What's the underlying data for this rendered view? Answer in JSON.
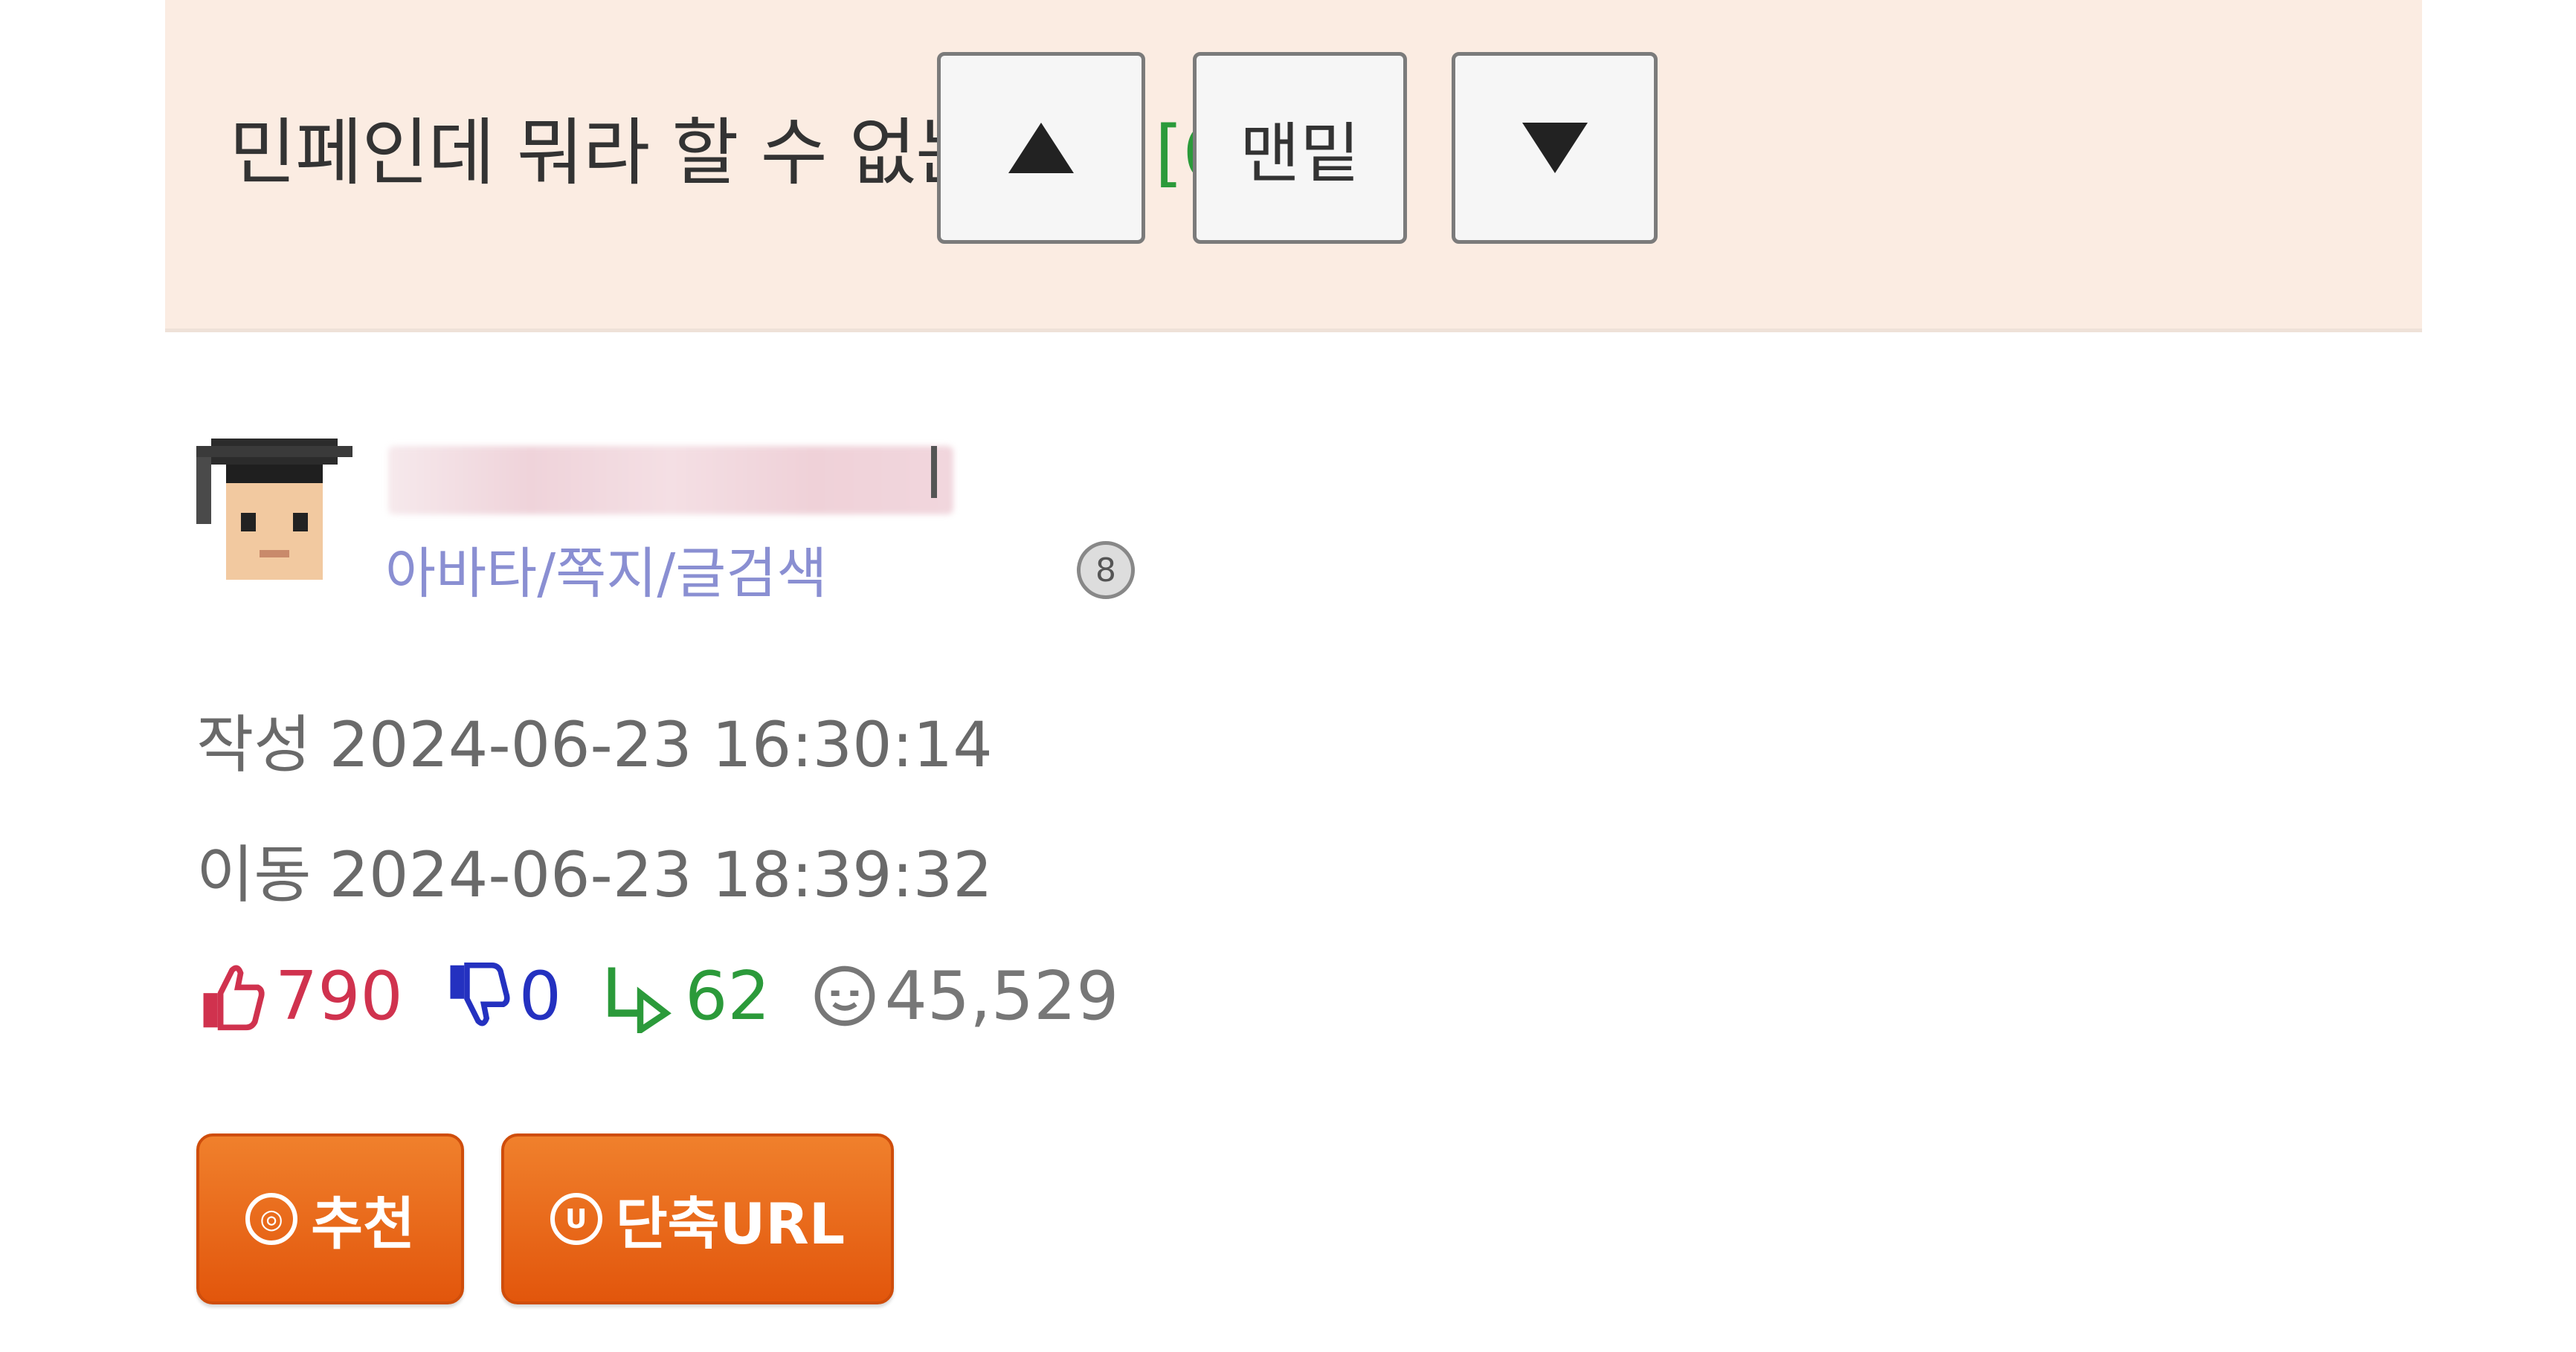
{
  "header": {
    "title": "민페인데 뭐라 할 수 없는 상황",
    "comment_count": "[62]",
    "buttons": {
      "up_icon": "triangle-up-icon",
      "bottom_label": "맨밑",
      "down_icon": "triangle-down-icon"
    }
  },
  "author": {
    "menu_link": "아바타/쪽지/글검색",
    "level_badge": "8"
  },
  "meta": {
    "written_label": "작성",
    "written_time": "2024-06-23 16:30:14",
    "moved_label": "이동",
    "moved_time": "2024-06-23 18:39:32"
  },
  "stats": {
    "upvotes": "790",
    "downvotes": "0",
    "replies": "62",
    "views": "45,529"
  },
  "actions": {
    "recommend_icon_text": "◎",
    "recommend_label": "추천",
    "short_url_icon_text": "U",
    "short_url_label": "단축URL"
  },
  "colors": {
    "header_bg": "#fbece2",
    "count_green": "#2b9a3a",
    "link_purple": "#8a8fd2",
    "upvote_red": "#d0324e",
    "downvote_blue": "#2431c0",
    "button_orange": "#ec6a1a"
  }
}
